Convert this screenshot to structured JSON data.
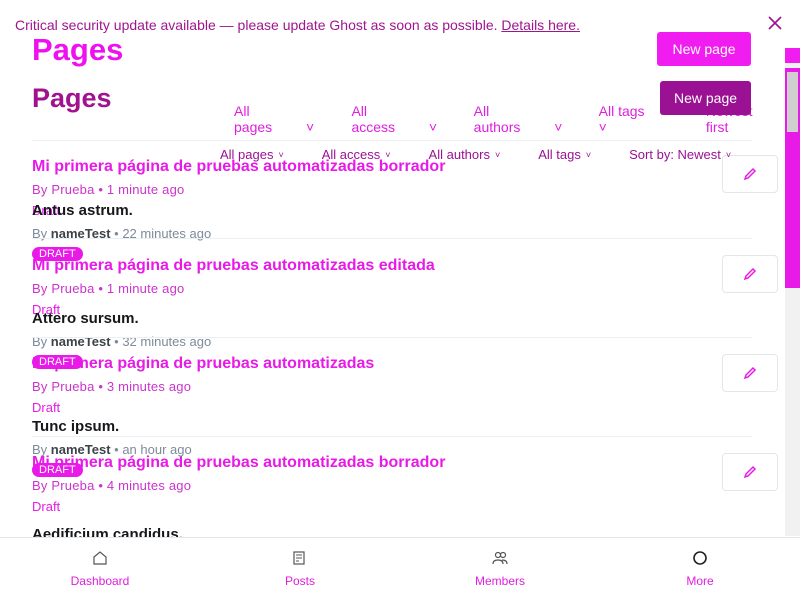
{
  "banner": {
    "text": "Critical security update available — please update Ghost as soon as possible.",
    "link": "Details here."
  },
  "header": {
    "title": "Pages",
    "new_page_label": "New page"
  },
  "filters": {
    "all_pages": "All pages",
    "all_access": "All access",
    "all_authors": "All authors",
    "all_tags": "All tags",
    "sort": "Sort by: Newest"
  },
  "pages": [
    {
      "title": "Antus astrum.",
      "author": "nameTest",
      "time": "22 minutes ago",
      "status": "DRAFT"
    },
    {
      "title": "Attero sursum.",
      "author": "nameTest",
      "time": "32 minutes ago",
      "status": "DRAFT"
    },
    {
      "title": "Tunc ipsum.",
      "author": "nameTest",
      "time": "an hour ago",
      "status": "DRAFT"
    },
    {
      "title": "Aedificium candidus.",
      "author": "",
      "time": "",
      "status": ""
    }
  ],
  "ghost_pages": [
    {
      "title": "Mi primera página de pruebas automatizadas borrador",
      "meta": "By Prueba • 1 minute ago",
      "status": "Draft"
    },
    {
      "title": "Mi primera página de pruebas automatizadas editada",
      "meta": "By Prueba • 1 minute ago",
      "status": "Draft"
    },
    {
      "title": "Mi primera página de pruebas automatizadas",
      "meta": "By Prueba • 3 minutes ago",
      "status": "Draft"
    },
    {
      "title": "Mi primera página de pruebas automatizadas borrador",
      "meta": "By Prueba • 4 minutes ago",
      "status": "Draft"
    }
  ],
  "ghost_filters": {
    "all_pages": "All pages",
    "all_access": "All access",
    "all_authors": "All authors",
    "all_tags": "All tags",
    "sort": "Newest first"
  },
  "nav": {
    "dashboard": "Dashboard",
    "posts": "Posts",
    "members": "Members",
    "more": "More"
  },
  "by_label": "By",
  "colors": {
    "accent": "#e81ae8",
    "brand_dark": "#9b1193"
  }
}
